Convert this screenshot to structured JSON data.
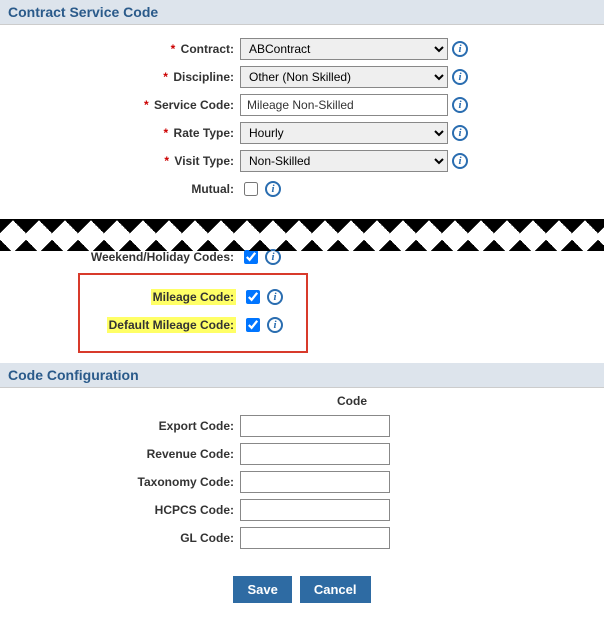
{
  "sections": {
    "contract_service_code": "Contract Service Code",
    "code_configuration": "Code Configuration"
  },
  "fields": {
    "contract": {
      "label": "Contract:",
      "value": "ABContract"
    },
    "discipline": {
      "label": "Discipline:",
      "value": "Other (Non Skilled)"
    },
    "service_code": {
      "label": "Service Code:",
      "value": "Mileage Non-Skilled"
    },
    "rate_type": {
      "label": "Rate Type:",
      "value": "Hourly"
    },
    "visit_type": {
      "label": "Visit Type:",
      "value": "Non-Skilled"
    },
    "mutual": {
      "label": "Mutual:",
      "checked": false
    },
    "weekend_holiday": {
      "label": "Weekend/Holiday Codes:",
      "checked": true
    },
    "mileage_code": {
      "label": "Mileage Code:",
      "checked": true
    },
    "default_mileage_code": {
      "label": "Default Mileage Code:",
      "checked": true
    }
  },
  "code_section": {
    "subheader": "Code",
    "export_code": {
      "label": "Export Code:",
      "value": ""
    },
    "revenue_code": {
      "label": "Revenue Code:",
      "value": ""
    },
    "taxonomy_code": {
      "label": "Taxonomy Code:",
      "value": ""
    },
    "hcpcs_code": {
      "label": "HCPCS Code:",
      "value": ""
    },
    "gl_code": {
      "label": "GL Code:",
      "value": ""
    }
  },
  "buttons": {
    "save": "Save",
    "cancel": "Cancel"
  },
  "info_glyph": "i"
}
